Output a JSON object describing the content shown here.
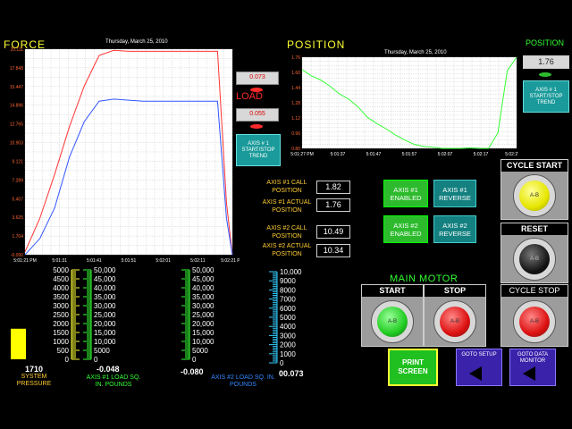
{
  "force": {
    "title": "FORCE",
    "date": "Thursday, March 25, 2010",
    "y_ticks": [
      "20.111",
      "17.848",
      "15.447",
      "14.896",
      "12.765",
      "10.903",
      "9.121",
      "7.289",
      "5.407",
      "3.625",
      "1.704",
      "-0.090"
    ],
    "x_ticks": [
      "5:01:21 PM",
      "5:01:31",
      "5:01:41",
      "5:01:51",
      "5:02:01",
      "5:02:11",
      "5:02:21 PM"
    ],
    "load_value_1": "0.073",
    "load_label": "LOAD",
    "load_value_2": "0.055",
    "trend_button": "AXIS # 1 START/STOP TREND"
  },
  "chart_data": [
    {
      "type": "line",
      "title": "",
      "x": [
        0,
        5,
        10,
        15,
        20,
        25,
        30,
        35,
        40,
        45,
        50,
        55,
        60,
        65,
        68,
        70
      ],
      "x_tick_labels": [
        "5:01:21 PM",
        "5:01:31",
        "5:01:41",
        "5:01:51",
        "5:02:01",
        "5:02:11",
        "5:02:21 PM"
      ],
      "series": [
        {
          "color": "#ff3333",
          "values": [
            0.2,
            3.5,
            7.8,
            12.5,
            16.5,
            19.5,
            20.0,
            19.9,
            19.9,
            19.9,
            19.9,
            19.9,
            19.9,
            19.9,
            5.0,
            -0.1
          ]
        },
        {
          "color": "#3355ff",
          "values": [
            -0.1,
            1.5,
            4.5,
            9.5,
            13.0,
            15.0,
            15.2,
            15.1,
            15.0,
            15.0,
            15.0,
            15.0,
            15.0,
            15.0,
            3.5,
            -0.1
          ]
        }
      ],
      "ylim": [
        -0.09,
        20.111
      ]
    },
    {
      "type": "line",
      "title": "",
      "x": [
        0,
        4,
        8,
        12,
        16,
        20,
        24,
        28,
        32,
        36,
        40,
        44,
        48,
        52,
        56,
        60,
        64,
        68,
        72,
        76,
        80,
        84,
        88,
        92
      ],
      "x_tick_labels": [
        "5:01:27 PM",
        "5:01:37",
        "5:01:47",
        "5:01:57",
        "5:02:07",
        "5:02:17",
        "5:02:27 PM"
      ],
      "series": [
        {
          "color": "#33ff33",
          "values": [
            1.52,
            1.4,
            1.32,
            1.2,
            1.05,
            0.95,
            0.8,
            0.6,
            0.48,
            0.38,
            0.26,
            0.16,
            0.08,
            0.04,
            0.02,
            0.0,
            0.0,
            0.0,
            0.01,
            0.0,
            0.0,
            0.3,
            1.5,
            1.76
          ]
        }
      ],
      "ylim": [
        0,
        1.76
      ]
    }
  ],
  "position": {
    "title": "POSITION",
    "date": "Thursday, March 25, 2010",
    "y_ticks": [
      "1.76",
      "1.60",
      "1.44",
      "1.28",
      "1.12",
      "0.96",
      "0.80"
    ],
    "x_ticks": [
      "5:01:27 PM",
      "5:01:37",
      "5:01:47",
      "5:01:57",
      "5:02:07",
      "5:02:17",
      "5:02:27 PM"
    ],
    "right_label": "POSITION",
    "right_value": "1.76",
    "trend_button": "AXIS # 1 START/STOP TREND"
  },
  "axis": {
    "call1_label": "AXIS #1 CALL POSITION",
    "call1_value": "1.82",
    "actual1_label": "AXIS #1 ACTUAL POSITION",
    "actual1_value": "1.76",
    "call2_label": "AXIS #2 CALL POSITION",
    "call2_value": "10.49",
    "actual2_label": "AXIS #2 ACTUAL POSITION",
    "actual2_value": "10.34",
    "ax1_enabled": "AXIS #1 ENABLED",
    "ax1_reverse": "AXIS #1 REVERSE",
    "ax2_enabled": "AXIS #2 ENABLED",
    "ax2_reverse": "AXIS #2 REVERSE"
  },
  "controls": {
    "cycle_start": "CYCLE START",
    "reset": "RESET",
    "main_motor": "MAIN MOTOR",
    "start": "START",
    "stop": "STOP",
    "cycle_stop": "CYCLE STOP",
    "print_screen": "PRINT SCREEN",
    "goto_setup": "GOTO SETUP",
    "goto_data_monitor": "GOTO DATA MONITOR",
    "btn_glyph": "A-B"
  },
  "gauges": {
    "pressure_scale": [
      "5000",
      "4500",
      "4000",
      "3500",
      "3000",
      "2500",
      "2000",
      "1500",
      "1000",
      "500",
      "0"
    ],
    "pressure_value": "1710",
    "pressure_fraction": 0.342,
    "pressure_label": "SYSTEM PRESSURE",
    "load1_scale": [
      "50,000",
      "45,000",
      "40,000",
      "35,000",
      "30,000",
      "25,000",
      "20,000",
      "15,000",
      "10,000",
      "5000",
      "0"
    ],
    "load1_value": "-0.048",
    "load1_label": "AXIS #1 LOAD SQ. IN. POUNDS",
    "load2_scale": [
      "50,000",
      "45,000",
      "40,000",
      "35,000",
      "30,000",
      "25,000",
      "20,000",
      "15,000",
      "10,000",
      "5000",
      "0"
    ],
    "load2_value": "-0.080",
    "load2_label": "AXIS #2 LOAD SQ. IN. POUNDS",
    "load3_scale": [
      "10,000",
      "9000",
      "8000",
      "7000",
      "6000",
      "5000",
      "4000",
      "3000",
      "2000",
      "1000",
      "0"
    ],
    "load3_value": "00.073"
  }
}
